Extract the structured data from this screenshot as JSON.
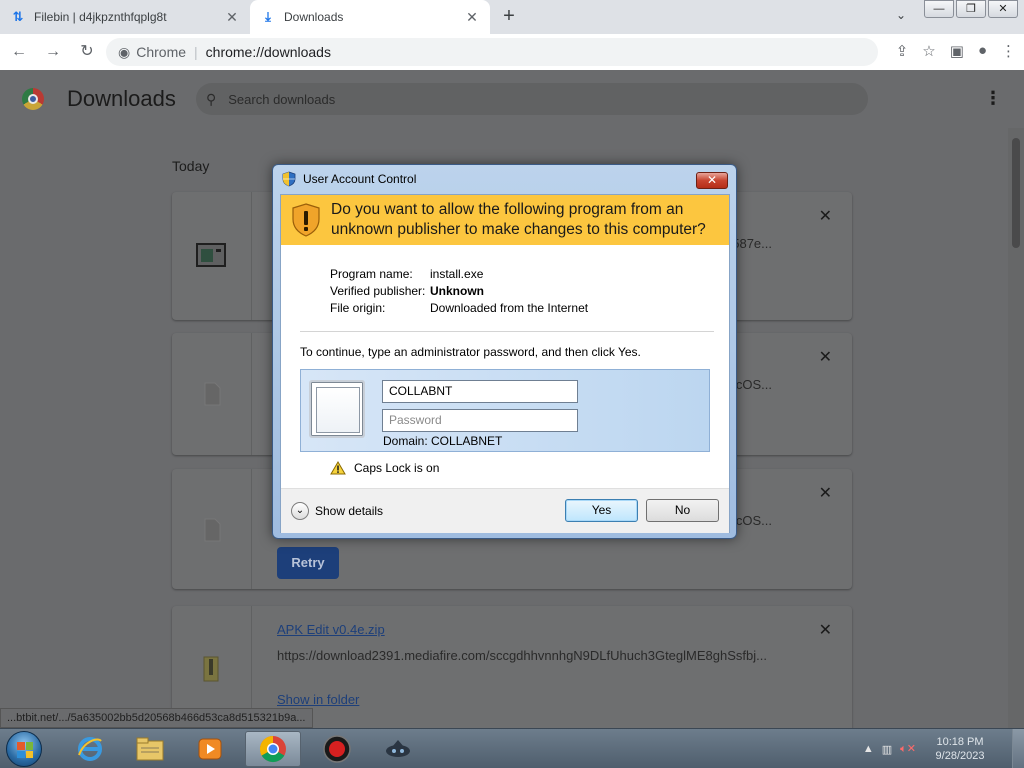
{
  "browser": {
    "tabs": [
      {
        "title": "Filebin | d4jkpznthfqplg8t",
        "icon": "filebin-icon"
      },
      {
        "title": "Downloads",
        "icon": "download-icon"
      }
    ],
    "new_tab_label": "+",
    "omnibox": {
      "site": "Chrome",
      "url": "chrome://downloads"
    }
  },
  "downloads_page": {
    "title": "Downloads",
    "search_placeholder": "Search downloads",
    "section_label": "Today",
    "items": [
      {
        "name": "",
        "url_truncated": "587e...",
        "has_retry": false
      },
      {
        "name": "",
        "url_truncated": "ecOS...",
        "has_retry": false
      },
      {
        "name": "",
        "url_truncated": "ecOS...",
        "has_retry": true,
        "retry_label": "Retry"
      },
      {
        "name": "APK Edit v0.4e.zip",
        "url": "https://download2391.mediafire.com/sccgdhhvnnhgN9DLfUhuch3GteglME8ghSsfbj...",
        "show_in_folder": "Show in folder"
      }
    ],
    "status_url": "...btbit.net/.../5a635002bb5d20568b466d53ca8d515321b9a..."
  },
  "uac_dialog": {
    "title": "User Account Control",
    "close_label": "✕",
    "question": "Do you want to allow the following program from an unknown publisher to make changes to this computer?",
    "program_name_label": "Program name:",
    "program_name": "install.exe",
    "publisher_label": "Verified publisher:",
    "publisher": "Unknown",
    "origin_label": "File origin:",
    "origin": "Downloaded from the Internet",
    "instruction": "To continue, type an administrator password, and then click Yes.",
    "username": "COLLABNT",
    "password_placeholder": "Password",
    "domain": "Domain: COLLABNET",
    "caps_lock": "Caps Lock is on",
    "show_details": "Show details",
    "yes_label": "Yes",
    "no_label": "No"
  },
  "taskbar": {
    "apps": [
      "internet-explorer-icon",
      "file-explorer-icon",
      "media-player-icon",
      "chrome-icon",
      "screen-recorder-icon",
      "vpn-icon"
    ],
    "time": "10:18 PM",
    "date": "9/28/2023"
  },
  "colors": {
    "uac_warning_band": "#fcc63f",
    "link": "#1d3f7a",
    "retry_button": "#1d3f7a"
  }
}
